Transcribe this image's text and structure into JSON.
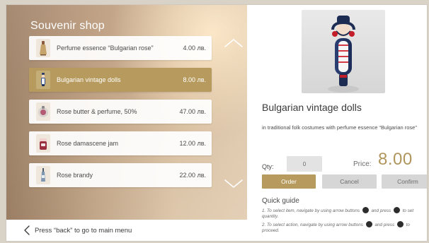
{
  "shop": {
    "title": "Souvenir shop",
    "back_text": "Press “back” to go to main menu"
  },
  "items": [
    {
      "name": "Perfume essence “Bulgarian rose”",
      "price": "4.00 лв."
    },
    {
      "name": "Bulgarian vintage dolls",
      "price": "8.00 лв."
    },
    {
      "name": "Rose butter & perfume, 50%",
      "price": "47.00 лв."
    },
    {
      "name": "Rose damascene jam",
      "price": "12.00 лв."
    },
    {
      "name": "Rose brandy",
      "price": "22.00 лв."
    }
  ],
  "selected_index": 1,
  "product": {
    "title": "Bulgarian vintage dolls",
    "description": "in traditional folk costumes with perfume essence “Bulgarian rose”",
    "qty_label": "Qty:",
    "qty_value": "0",
    "price_label": "Price:",
    "price_value": "8.00"
  },
  "actions": {
    "order": "Order",
    "cancel": "Cancel",
    "confirm": "Confirm"
  },
  "guide": {
    "title": "Quick guide",
    "line1_a": "1. To select item, navigate by using arrow buttons",
    "line1_b": "and press",
    "line1_c": "to set quantity.",
    "line2_a": "2. To select action, navigate by using arrow buttons",
    "line2_b": "and press",
    "line2_c": "to proceed."
  },
  "colors": {
    "accent": "#b79b5e",
    "button_gray": "#d6d6d6"
  },
  "icons": {
    "up": "chevron-up-icon",
    "down": "chevron-down-icon",
    "back": "chevron-left-icon"
  }
}
